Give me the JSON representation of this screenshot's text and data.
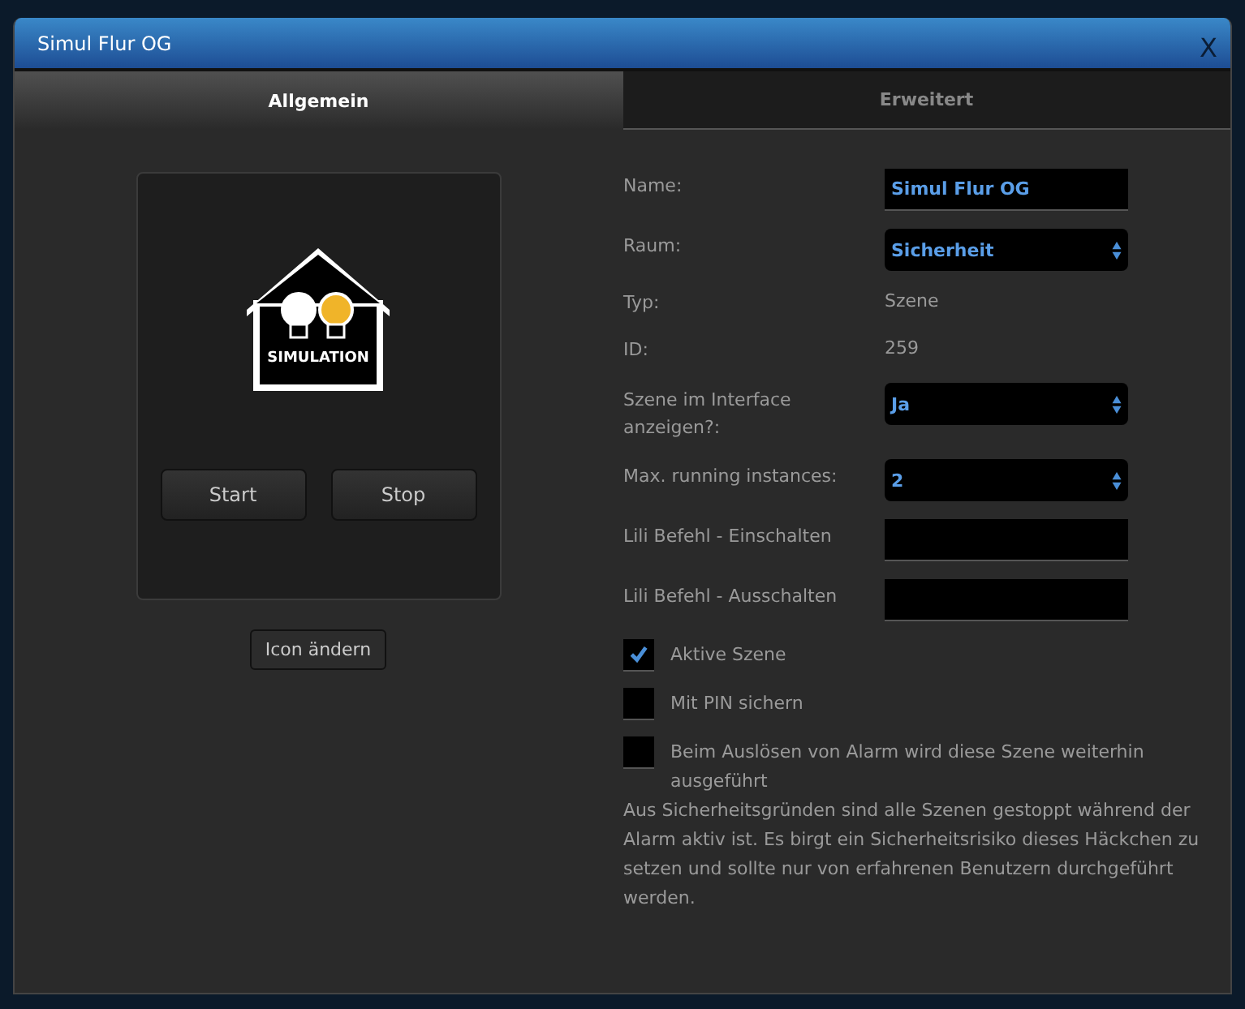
{
  "window": {
    "title": "Simul Flur OG",
    "close": "X"
  },
  "tabs": [
    {
      "label": "Allgemein",
      "selected": true
    },
    {
      "label": "Erweitert",
      "selected": false
    }
  ],
  "preview": {
    "icon_caption": "SIMULATION",
    "buttons": [
      "Start",
      "Stop"
    ],
    "change_icon": "Icon ändern"
  },
  "fields": [
    {
      "kind": "text",
      "label": "Name:",
      "value": "Simul Flur OG"
    },
    {
      "kind": "select",
      "label": "Raum:",
      "value": "Sicherheit"
    },
    {
      "kind": "static",
      "label": "Typ:",
      "value": "Szene"
    },
    {
      "kind": "static",
      "label": "ID:",
      "value": "259"
    },
    {
      "kind": "select",
      "label": "Szene im Interface anzeigen?:",
      "value": "Ja"
    },
    {
      "kind": "select",
      "label": "Max. running instances:",
      "value": "2"
    },
    {
      "kind": "text",
      "label": "Lili Befehl - Einschalten"
    },
    {
      "kind": "text",
      "label": "Lili Befehl - Ausschalten"
    }
  ],
  "checkboxes": [
    {
      "label": "Aktive Szene",
      "checked": true
    },
    {
      "label": "Mit PIN sichern",
      "checked": false
    },
    {
      "label": "Beim Auslösen von Alarm wird diese Szene weiterhin ausgeführt",
      "checked": false
    }
  ],
  "note": "Aus Sicherheitsgründen sind alle Szenen gestoppt während der Alarm aktiv ist. Es birgt ein Sicherheitsrisiko dieses Häckchen zu setzen und sollte nur von erfahrenen Benutzern durchgeführt werden."
}
